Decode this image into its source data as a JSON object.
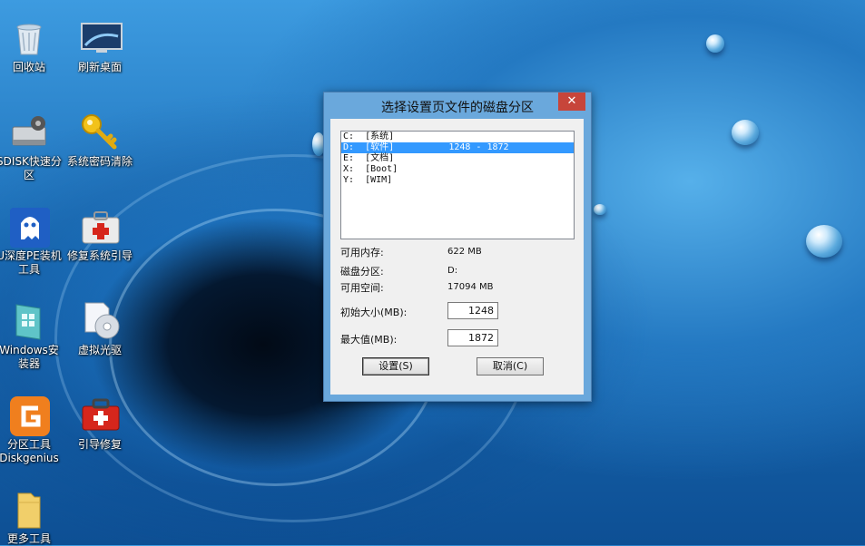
{
  "desktop_icons": [
    {
      "label": "回收站",
      "icon": "recycle-bin-icon"
    },
    {
      "label": "刷新桌面",
      "icon": "monitor-icon"
    },
    {
      "label": "SDISK快速分\n区",
      "icon": "disk-drive-icon"
    },
    {
      "label": "系统密码清除",
      "icon": "key-icon"
    },
    {
      "label": "U深度PE装机\n工具",
      "icon": "ghost-icon"
    },
    {
      "label": "修复系统引导",
      "icon": "first-aid-kit-icon"
    },
    {
      "label": "Windows安\n装器",
      "icon": "windows-installer-icon"
    },
    {
      "label": "虚拟光驱",
      "icon": "virtual-drive-icon"
    },
    {
      "label": "分区工具\nDiskgenius",
      "icon": "diskgenius-icon"
    },
    {
      "label": "引导修复",
      "icon": "toolbox-icon"
    },
    {
      "label": "更多工具",
      "icon": "folder-icon"
    }
  ],
  "dialog": {
    "title": "选择设置页文件的磁盘分区",
    "close": "✕",
    "partitions": [
      {
        "text": "C:  [系统]",
        "selected": false
      },
      {
        "text": "D:  [软件]          1248 - 1872",
        "selected": true
      },
      {
        "text": "E:  [文档]",
        "selected": false
      },
      {
        "text": "X:  [Boot]",
        "selected": false
      },
      {
        "text": "Y:  [WIM]",
        "selected": false
      }
    ],
    "available_memory_label": "可用内存:",
    "available_memory_value": "622 MB",
    "partition_label": "磁盘分区:",
    "partition_value": "D:",
    "free_space_label": "可用空间:",
    "free_space_value": "17094 MB",
    "initial_size_label": "初始大小(MB):",
    "initial_size_value": "1248",
    "max_size_label": "最大值(MB):",
    "max_size_value": "1872",
    "set_button": "设置(S)",
    "cancel_button": "取消(C)"
  },
  "colors": {
    "title_bar": "#6aa8dc",
    "close_button": "#c7453a",
    "selection": "#3399ff"
  }
}
